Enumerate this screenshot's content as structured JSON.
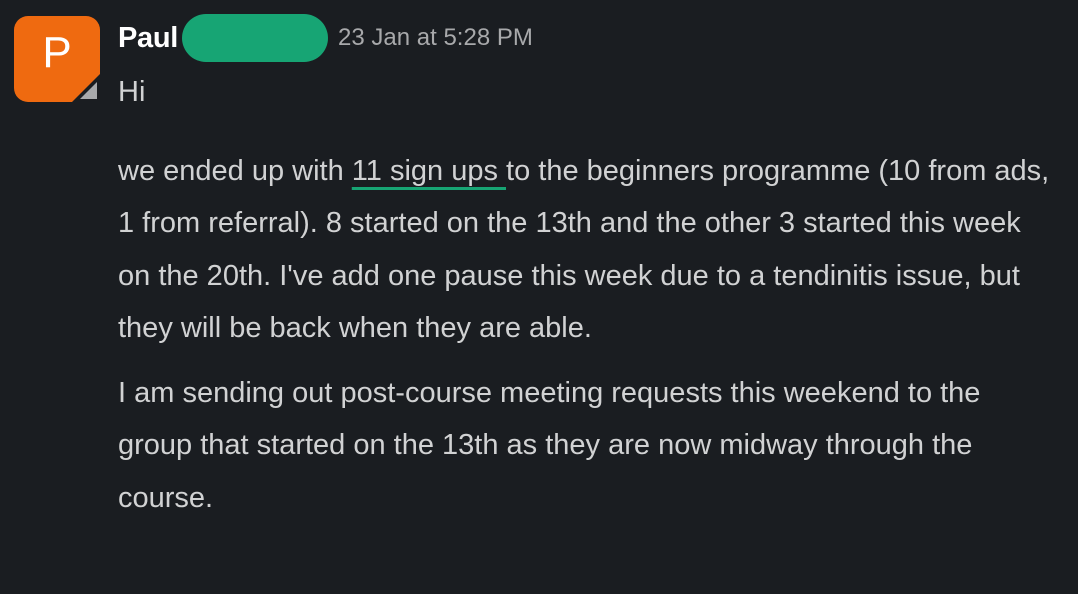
{
  "message": {
    "avatar_letter": "P",
    "author_name": "Paul",
    "timestamp": "23 Jan at 5:28 PM",
    "greeting": "Hi",
    "paragraph1_before": "we ended up with ",
    "paragraph1_highlight": "11 sign ups ",
    "paragraph1_after": "to the beginners programme (10 from ads, 1 from referral). 8 started on the 13th and the other 3 started this week on the 20th. I've add one pause this week due to a tendinitis issue, but they will be back when they are able.",
    "paragraph2": "I am sending out post-course meeting requests this weekend to the group that started on the 13th as they are now midway through the course."
  },
  "colors": {
    "background": "#1a1d21",
    "avatar": "#ef6a10",
    "redaction": "#17a574",
    "underline": "#17a574",
    "text": "#d1d2d3",
    "timestamp": "#a8a9ab"
  }
}
